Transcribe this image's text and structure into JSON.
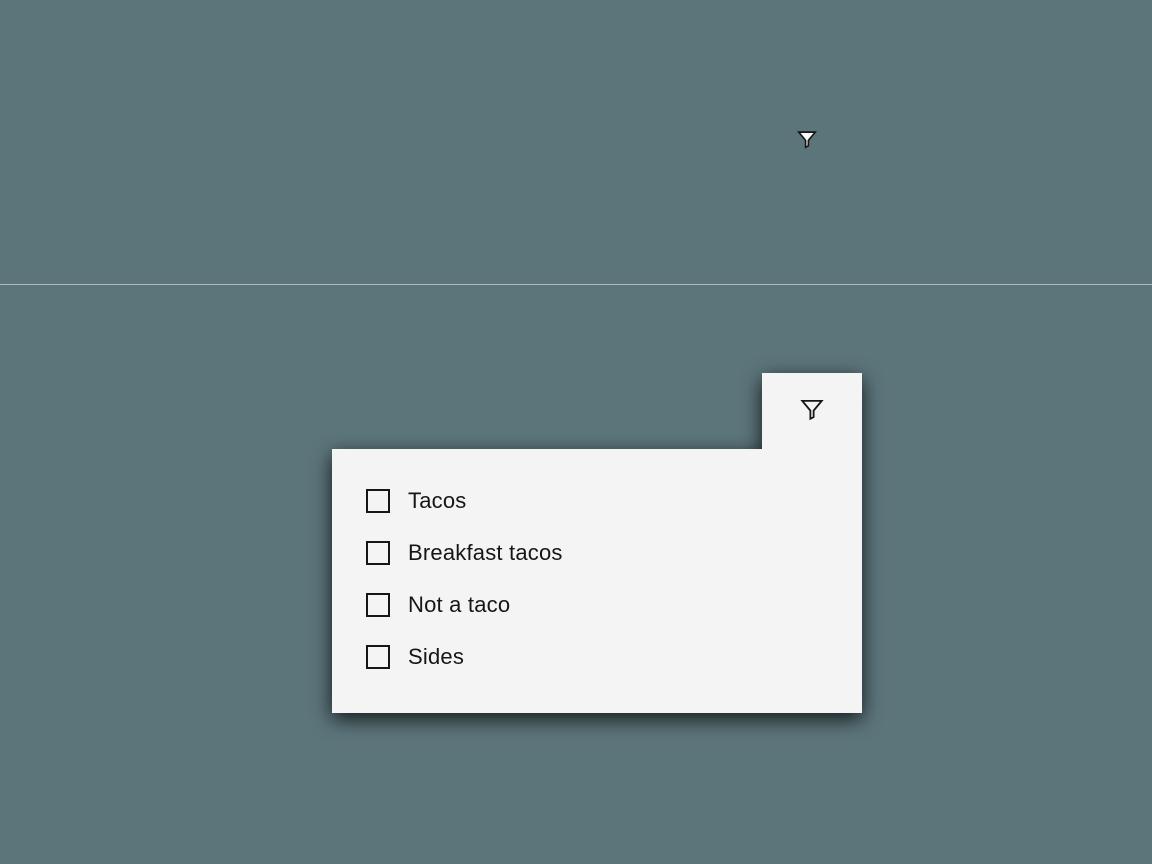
{
  "filter": {
    "icons": {
      "small": "filter-icon",
      "tab": "filter-icon"
    },
    "options": [
      {
        "label": "Tacos",
        "checked": false
      },
      {
        "label": "Breakfast tacos",
        "checked": false
      },
      {
        "label": "Not a taco",
        "checked": false
      },
      {
        "label": "Sides",
        "checked": false
      }
    ]
  },
  "colors": {
    "background": "#5c757b",
    "panel": "#f4f4f4",
    "text": "#161616"
  }
}
